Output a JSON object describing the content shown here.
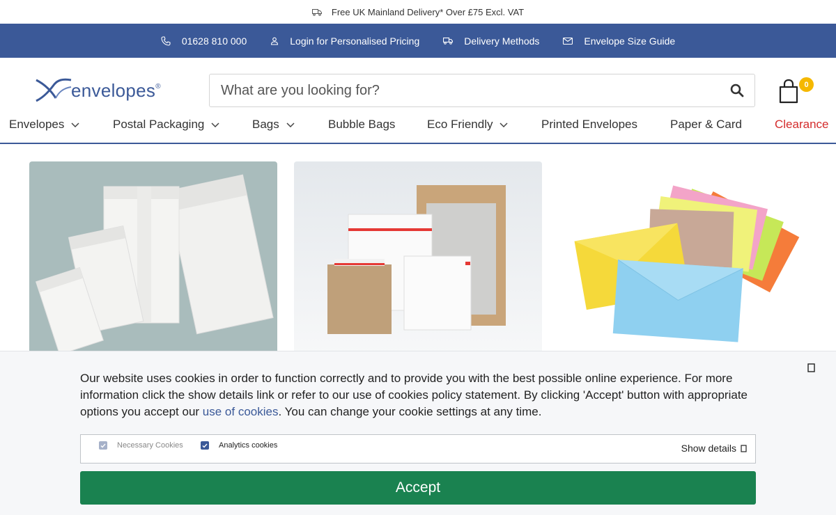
{
  "promo": {
    "text": "Free UK Mainland Delivery* Over £75 Excl. VAT"
  },
  "top_bar": {
    "phone": "01628 810 000",
    "login": "Login for Personalised Pricing",
    "delivery": "Delivery Methods",
    "size_guide": "Envelope Size Guide"
  },
  "logo": {
    "text": "envelopes",
    "mark": "®"
  },
  "search": {
    "placeholder": "What are you looking for?"
  },
  "cart": {
    "count": "0"
  },
  "nav": {
    "items": [
      {
        "label": "Envelopes",
        "has_dropdown": true
      },
      {
        "label": "Postal Packaging",
        "has_dropdown": true
      },
      {
        "label": "Bags",
        "has_dropdown": true
      },
      {
        "label": "Bubble Bags",
        "has_dropdown": false
      },
      {
        "label": "Eco Friendly",
        "has_dropdown": true
      },
      {
        "label": "Printed Envelopes",
        "has_dropdown": false
      },
      {
        "label": "Paper & Card",
        "has_dropdown": false
      },
      {
        "label": "Clearance",
        "has_dropdown": false
      }
    ]
  },
  "cookie": {
    "text_before": "Our website uses cookies in order to function correctly and to provide you with the best possible online experience. For more information click the show details link or refer to our use of cookies policy statement. By clicking 'Accept' button with appropriate options you accept our ",
    "link_text": "use of cookies",
    "text_after": ". You can change your cookie settings at any time.",
    "option_necessary": "Necessary Cookies",
    "option_analytics": "Analytics cookies",
    "show_details": "Show details",
    "accept": "Accept"
  },
  "colors": {
    "brand_blue": "#3b5998",
    "accept_green": "#1a8250",
    "clearance_red": "#d42c2c",
    "badge_yellow": "#f5b800"
  },
  "icons": [
    "truck-icon",
    "phone-icon",
    "user-icon",
    "envelope-icon",
    "search-icon",
    "shopping-bag-icon",
    "chevron-down-icon",
    "close-icon",
    "checkmark-icon"
  ]
}
